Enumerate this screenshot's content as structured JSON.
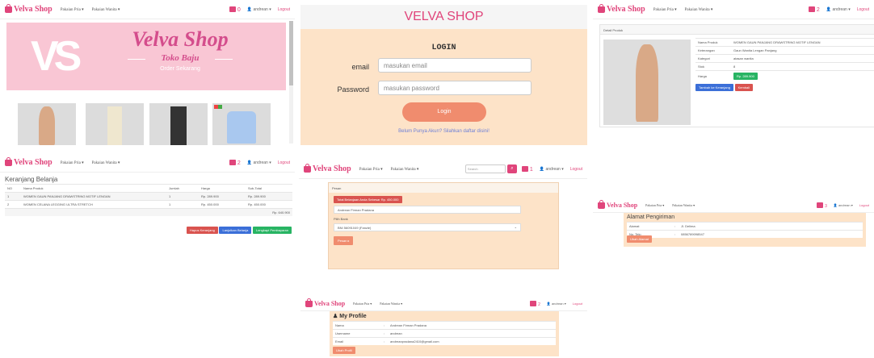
{
  "colors": {
    "brand_pink": "#e0457b",
    "peach_bg": "#fde3c8",
    "salmon_btn": "#f08c6e",
    "green_badge": "#28b463",
    "login_blue": "#6c7fd8"
  },
  "nav": {
    "brand": "Velva Shop",
    "menu_pria": "Pakaian Pria ▾",
    "menu_wanita": "Pakaian Wanita ▾",
    "user": "andrean ▾",
    "logout": "Logout",
    "search_placeholder": "Search"
  },
  "home": {
    "cart_count": "0",
    "banner_title": "Velva Shop",
    "banner_subtitle": "Toko Baju",
    "banner_cta": "Order Sekarang",
    "banner_logo": "VS"
  },
  "login": {
    "header": "VELVA SHOP",
    "title": "LOGIN",
    "email_label": "email",
    "email_placeholder": "masukan email",
    "password_label": "Password",
    "password_placeholder": "masukan password",
    "button": "Login",
    "register_link": "Belum Punya Akun? Silahkan daftar disini!"
  },
  "detail": {
    "cart_count": "2",
    "section": "Detail Produk",
    "rows": [
      {
        "label": "Nama Produk",
        "value": "WOMEN GAUN PANJANG DRAWSTRING MOTIF LENGAN"
      },
      {
        "label": "Keterangan",
        "value": "Gaun Wanita Lengan Panjang"
      },
      {
        "label": "Kategori",
        "value": "atasan wanita"
      },
      {
        "label": "Stok",
        "value": "8"
      },
      {
        "label": "Harga",
        "value": "Rp. 289.900"
      }
    ],
    "btn_add": "Tambah ke Keranjang",
    "btn_back": "Kembali"
  },
  "cart": {
    "cart_count": "2",
    "title": "Keranjang Belanja",
    "columns": [
      "NO",
      "Nama Produk",
      "Jumlah",
      "Harga",
      "Sub-Total"
    ],
    "rows": [
      [
        "1",
        "WOMEN GAUN PANJANG DRAWSTRING MOTIF LENGAN",
        "1",
        "Rp. 289.900",
        "Rp. 289.900"
      ],
      [
        "2",
        "WOMEN CELANA LEGGING ULTRA STRETCH",
        "1",
        "Rp. 450.000",
        "Rp. 450.000"
      ]
    ],
    "total": "Rp. 640.900",
    "btn_clear": "Hapus Keranjang",
    "btn_continue": "Lanjutkan Belanja",
    "btn_checkout": "Lengkapi Pembayaran"
  },
  "checkout": {
    "cart_count": "1",
    "section": "Pesan",
    "total_badge": "Total Belanjaan Anda Sebesar Rp. 450.000",
    "name_value": "Andrean Firman Pradana",
    "pay_label": "Pilih Bank",
    "pay_value": "BNI 56091049 (Fanzie)",
    "btn_order": "Pesan ▸"
  },
  "address": {
    "cart_count": "3",
    "title": "Alamat Pengiriman",
    "rows": [
      {
        "label": "Alamat",
        "value": "Jl. Delima"
      },
      {
        "label": "No. Telp",
        "value": "0856789098547"
      }
    ],
    "btn": "Ubah Alamat"
  },
  "profile": {
    "cart_count": "2",
    "title": "My Profile",
    "rows": [
      {
        "label": "Nama",
        "value": "Andrean Firman Pradana"
      },
      {
        "label": "Username",
        "value": "andrean"
      },
      {
        "label": "Email",
        "value": "andreanpradana2410@gmail.com"
      }
    ],
    "btn": "Ubah Profil"
  }
}
